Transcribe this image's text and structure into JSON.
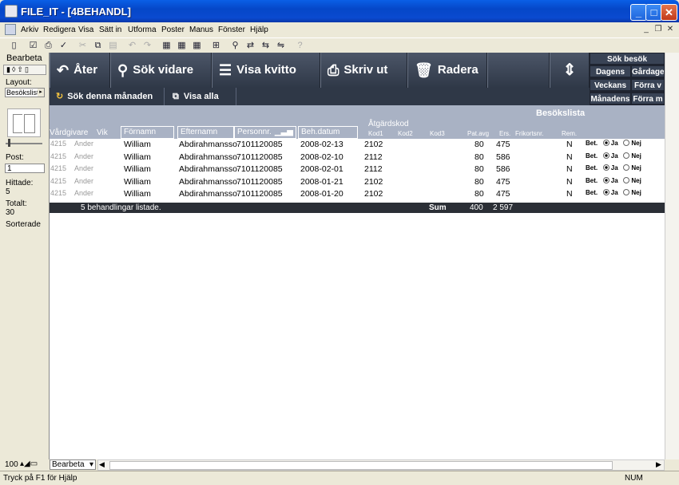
{
  "window": {
    "title": "FILE_IT - [4BEHANDL]"
  },
  "menu": [
    "Arkiv",
    "Redigera",
    "Visa",
    "Sätt in",
    "Utforma",
    "Poster",
    "Manus",
    "Fönster",
    "Hjälp"
  ],
  "status_area": {
    "mode": "Bearbeta",
    "layout_label": "Layout:",
    "layout_value": "Besökslist",
    "post_label": "Post:",
    "post_value": "1",
    "found_label": "Hittade:",
    "found_value": "5",
    "total_label": "Totalt:",
    "total_value": "30",
    "sorted": "Sorterade"
  },
  "buttons": {
    "back": "Åter",
    "search_more": "Sök vidare",
    "show_receipt": "Visa kvitto",
    "print": "Skriv ut",
    "delete": "Radera",
    "search_month": "Sök denna månaden",
    "show_all": "Visa alla"
  },
  "nav": {
    "sok_besok": "Sök besök",
    "dagens": "Dagens",
    "gardagens": "Gårdage",
    "veckans": "Veckans",
    "forra_v": "Förra v",
    "manadens": "Månadens",
    "forra_m": "Förra m"
  },
  "list": {
    "title": "Besökslista",
    "group_atgard": "Åtgärdskod",
    "headers": {
      "vardgivare": "Vårdgivare",
      "vik": "Vik",
      "fornamn": "Förnamn",
      "efternamn": "Efternamn",
      "personnr": "Personnr.",
      "behdatum": "Beh.datum",
      "kod1": "Kod1",
      "kod2": "Kod2",
      "kod3": "Kod3",
      "patavg": "Pat.avg",
      "ers": "Ers.",
      "frikortsnr": "Frikortsnr.",
      "rem": "Rem."
    },
    "rows": [
      {
        "vg": "4215",
        "vik": "Ander",
        "fn": "William",
        "en": "Abdirahmansso",
        "pnr": "7101120085",
        "date": "2008-02-13",
        "kod1": "2102",
        "pat": "80",
        "ers": "475",
        "rem": "N"
      },
      {
        "vg": "4215",
        "vik": "Ander",
        "fn": "William",
        "en": "Abdirahmansso",
        "pnr": "7101120085",
        "date": "2008-02-10",
        "kod1": "2112",
        "pat": "80",
        "ers": "586",
        "rem": "N"
      },
      {
        "vg": "4215",
        "vik": "Ander",
        "fn": "William",
        "en": "Abdirahmansso",
        "pnr": "7101120085",
        "date": "2008-02-01",
        "kod1": "2112",
        "pat": "80",
        "ers": "586",
        "rem": "N"
      },
      {
        "vg": "4215",
        "vik": "Ander",
        "fn": "William",
        "en": "Abdirahmansso",
        "pnr": "7101120085",
        "date": "2008-01-21",
        "kod1": "2102",
        "pat": "80",
        "ers": "475",
        "rem": "N"
      },
      {
        "vg": "4215",
        "vik": "Ander",
        "fn": "William",
        "en": "Abdirahmansso",
        "pnr": "7101120085",
        "date": "2008-01-20",
        "kod1": "2102",
        "pat": "80",
        "ers": "475",
        "rem": "N"
      }
    ],
    "bet_label": "Bet.",
    "ja": "Ja",
    "nej": "Nej",
    "summary": "5 behandlingar listade.",
    "sum_label": "Sum",
    "sum_pat": "400",
    "sum_ers": "2 597"
  },
  "bottom": {
    "zoom": "100",
    "mode": "Bearbeta"
  },
  "statusbar": {
    "help": "Tryck på F1 för Hjälp",
    "num": "NUM"
  }
}
